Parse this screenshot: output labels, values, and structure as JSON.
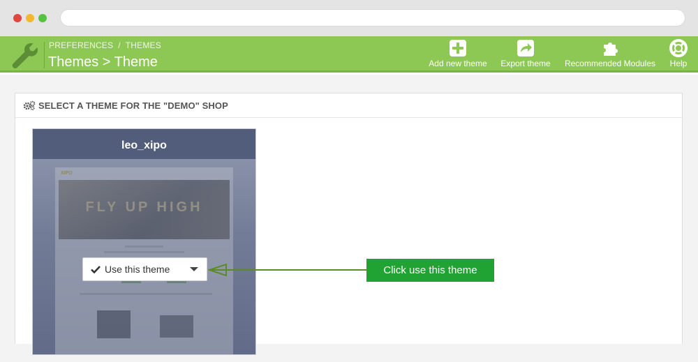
{
  "toolbar": {
    "breadcrumb": [
      "PREFERENCES",
      "THEMES"
    ],
    "title": "Themes > Theme",
    "actions": [
      {
        "label": "Add new theme",
        "icon": "add-icon"
      },
      {
        "label": "Export theme",
        "icon": "export-icon"
      },
      {
        "label": "Recommended Modules",
        "icon": "puzzle-icon"
      },
      {
        "label": "Help",
        "icon": "lifebuoy-icon"
      }
    ],
    "color": "#8dc855"
  },
  "panel": {
    "title": "SELECT A THEME FOR THE \"DEMO\" SHOP",
    "icon": "cogs-icon"
  },
  "theme_card": {
    "name": "leo_xipo",
    "preview_logo": "XIPO",
    "preview_hero_text": "FLY UP HIGH",
    "header_color": "#525d7b"
  },
  "use_button": {
    "label": "Use this theme",
    "icon": "check-icon"
  },
  "annotation": {
    "text": "Click use this theme",
    "color": "#21a334"
  }
}
